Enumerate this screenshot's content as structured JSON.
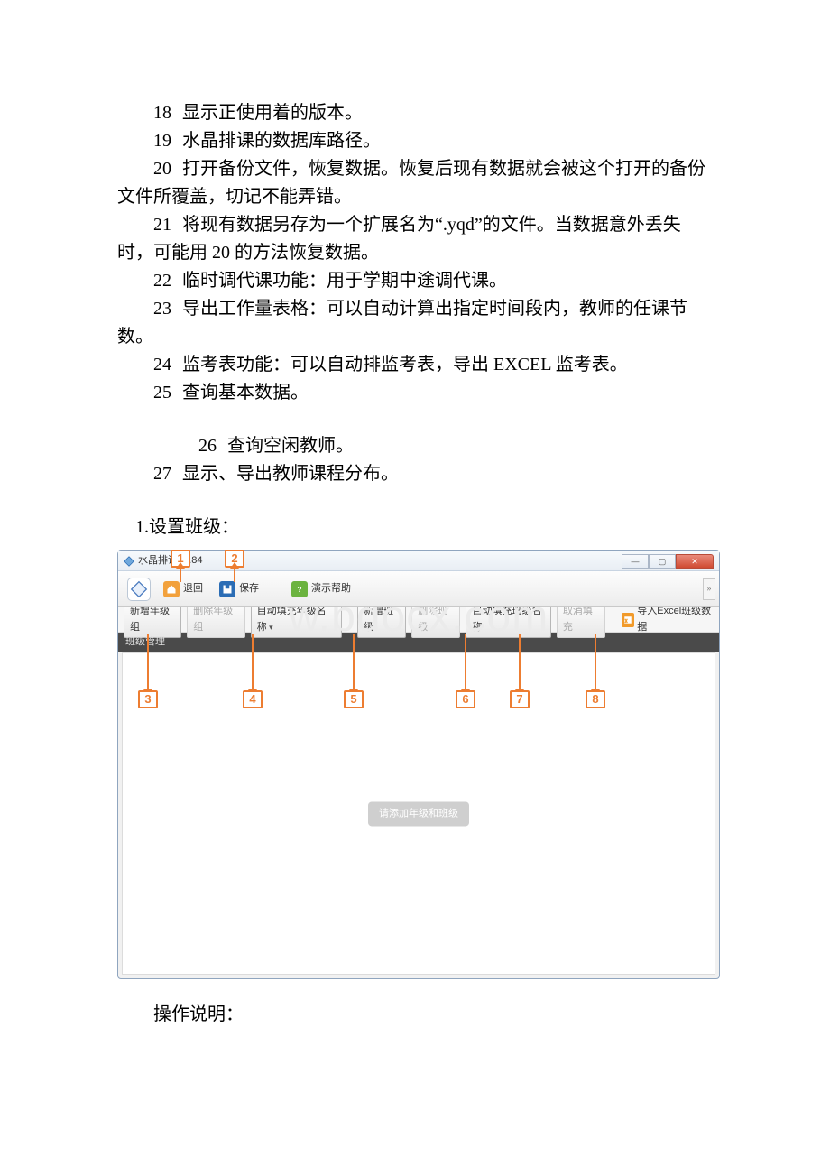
{
  "items": [
    {
      "num": "18",
      "text": "显示正使用着的版本。"
    },
    {
      "num": "19",
      "text": "水晶排课的数据库路径。"
    },
    {
      "num": "20",
      "text": "打开备份文件，恢复数据。恢复后现有数据就会被这个打开的备份文件所覆盖，切记不能弄错。"
    },
    {
      "num": "21",
      "text": "将现有数据另存为一个扩展名为“.yqd”的文件。当数据意外丢失时，可能用 20 的方法恢复数据。"
    },
    {
      "num": "22",
      "text": "临时调代课功能：用于学期中途调代课。"
    },
    {
      "num": "23",
      "text": "导出工作量表格：可以自动计算出指定时间段内，教师的任课节数。"
    },
    {
      "num": "24",
      "text": "监考表功能：可以自动排监考表，导出 EXCEL 监考表。"
    },
    {
      "num": "25",
      "text": "查询基本数据。"
    },
    {
      "num": "26",
      "text": "查询空闲教师。"
    },
    {
      "num": "27",
      "text": "显示、导出教师课程分布。"
    }
  ],
  "section_heading": "1.设置班级：",
  "app": {
    "title": "水晶排课10.84",
    "watermark": "w.bdocx.com",
    "toolbar": {
      "back": "退回",
      "save": "保存",
      "help": "演示帮助",
      "expand": "»"
    },
    "toolbar2": {
      "add_grade_group": "新增年级组",
      "del_grade_group": "删除年级组",
      "autofill_grade": "自动填充年级名称",
      "add_class": "新增班级",
      "del_class": "删除班级",
      "autofill_class": "自动填充班级名称",
      "cancel_fill": "取消填充",
      "import_excel": "导入Excel班级数据"
    },
    "darkbar": "班级管理",
    "placeholder": "请添加年级和班级",
    "window_buttons": {
      "min": "—",
      "max": "▢",
      "close": "✕"
    }
  },
  "callouts": {
    "c1": "1",
    "c2": "2",
    "c3": "3",
    "c4": "4",
    "c5": "5",
    "c6": "6",
    "c7": "7",
    "c8": "8"
  },
  "post_caption": "操作说明："
}
